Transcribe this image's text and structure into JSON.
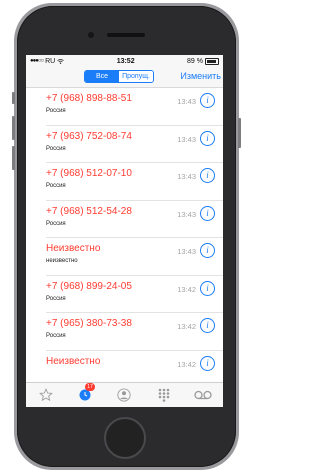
{
  "status_bar": {
    "signal": "●●●○○",
    "carrier": "RU",
    "time": "13:52",
    "battery": "89 %"
  },
  "nav": {
    "segment_all": "Все",
    "segment_missed": "Пропущ.",
    "edit": "Изменить"
  },
  "calls": [
    {
      "name": "+7 (968) 898-88-51",
      "label": "Россия",
      "time": "13:43"
    },
    {
      "name": "+7 (963) 752-08-74",
      "label": "Россия",
      "time": "13:43"
    },
    {
      "name": "+7 (968) 512-07-10",
      "label": "Россия",
      "time": "13:43"
    },
    {
      "name": "+7 (968) 512-54-28",
      "label": "Россия",
      "time": "13:43"
    },
    {
      "name": "Неизвестно",
      "label": "неизвестно",
      "time": "13:43"
    },
    {
      "name": "+7 (968) 899-24-05",
      "label": "Россия",
      "time": "13:42"
    },
    {
      "name": "+7 (965) 380-73-38",
      "label": "Россия",
      "time": "13:42"
    },
    {
      "name": "Неизвестно",
      "label": "",
      "time": "13:42"
    }
  ],
  "tabbar": {
    "recents_badge": "17"
  },
  "colors": {
    "accent": "#1b7df7",
    "missed": "#ff3b30"
  }
}
